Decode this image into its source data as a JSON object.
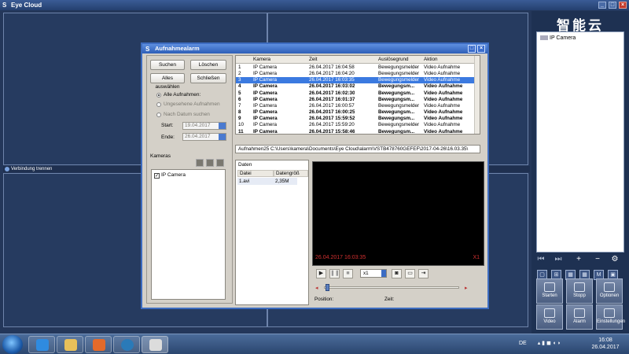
{
  "window": {
    "title": "Eye Cloud"
  },
  "main": {
    "status_text": "Verbindung trennen"
  },
  "right_panel": {
    "brand": "智能云",
    "tree_root": "IP Camera",
    "buttons": [
      {
        "label": "Starten"
      },
      {
        "label": "Stopp"
      },
      {
        "label": "Optionen"
      },
      {
        "label": "Video"
      },
      {
        "label": "Alarm"
      },
      {
        "label": "Einstellungen"
      }
    ]
  },
  "dialog": {
    "title": "Aufnahmealarm",
    "buttons": {
      "search": "Suchen",
      "delete": "Löschen",
      "select_all": "Alles auswählen",
      "close": "Schließen"
    },
    "filters": {
      "all": "Alle Aufnahmen:",
      "unseen": "Ungesehene Aufnahmen",
      "by_date": "Nach Datum suchen",
      "start_label": "Start:",
      "start_value": "19.04.2017",
      "end_label": "Ende:",
      "end_value": "26.04.2017",
      "selected": "all"
    },
    "cameras_label": "Kameras",
    "cameras": [
      {
        "name": "IP Camera",
        "checked": true
      }
    ],
    "table": {
      "columns": [
        "Kamera",
        "Zeit",
        "Auslösegrund",
        "Aktion"
      ],
      "rows": [
        {
          "n": "1",
          "camera": "IP Camera",
          "time": "26.04.2017 16:04:58",
          "reason": "Bewegungsmelder",
          "action": "Video Aufnahme",
          "bold": false,
          "selected": false
        },
        {
          "n": "2",
          "camera": "IP Camera",
          "time": "26.04.2017 16:04:20",
          "reason": "Bewegungsmelder",
          "action": "Video Aufnahme",
          "bold": false,
          "selected": false
        },
        {
          "n": "3",
          "camera": "IP Camera",
          "time": "26.04.2017 16:03:35",
          "reason": "Bewegungsmelder",
          "action": "Video Aufnahme",
          "bold": false,
          "selected": true
        },
        {
          "n": "4",
          "camera": "IP Camera",
          "time": "26.04.2017 16:03:02",
          "reason": "Bewegungsm...",
          "action": "Video Aufnahme",
          "bold": true,
          "selected": false
        },
        {
          "n": "5",
          "camera": "IP Camera",
          "time": "26.04.2017 16:02:30",
          "reason": "Bewegungsm...",
          "action": "Video Aufnahme",
          "bold": true,
          "selected": false
        },
        {
          "n": "6",
          "camera": "IP Camera",
          "time": "26.04.2017 16:01:37",
          "reason": "Bewegungsm...",
          "action": "Video Aufnahme",
          "bold": true,
          "selected": false
        },
        {
          "n": "7",
          "camera": "IP Camera",
          "time": "26.04.2017 16:00:57",
          "reason": "Bewegungsmelder",
          "action": "Video Aufnahme",
          "bold": false,
          "selected": false
        },
        {
          "n": "8",
          "camera": "IP Camera",
          "time": "26.04.2017 16:00:25",
          "reason": "Bewegungsm...",
          "action": "Video Aufnahme",
          "bold": true,
          "selected": false
        },
        {
          "n": "9",
          "camera": "IP Camera",
          "time": "26.04.2017 15:59:52",
          "reason": "Bewegungsm...",
          "action": "Video Aufnahme",
          "bold": true,
          "selected": false
        },
        {
          "n": "10",
          "camera": "IP Camera",
          "time": "26.04.2017 15:59:20",
          "reason": "Bewegungsmelder",
          "action": "Video Aufnahme",
          "bold": false,
          "selected": false
        },
        {
          "n": "11",
          "camera": "IP Camera",
          "time": "26.04.2017 15:58:46",
          "reason": "Bewegungsm...",
          "action": "Video Aufnahme",
          "bold": true,
          "selected": false
        }
      ]
    },
    "path": "Aufnahmen25   C:\\Users\\kamera\\Documents\\Eye Cloud\\alarm\\VSTB478760GEFEF\\2017-04-26\\16.03.35\\",
    "files": {
      "title": "Daten",
      "columns": [
        "Datei",
        "Datengröß"
      ],
      "rows": [
        {
          "file": "1.avi",
          "size": "2,35M"
        }
      ]
    },
    "player": {
      "timestamp": "26.04.2017 16:03:35",
      "channel": "X1",
      "speed": "x1",
      "position_label": "Position:",
      "time_label": "Zeit:"
    }
  },
  "taskbar": {
    "language": "DE",
    "time": "16:08",
    "date": "26.04.2017"
  }
}
